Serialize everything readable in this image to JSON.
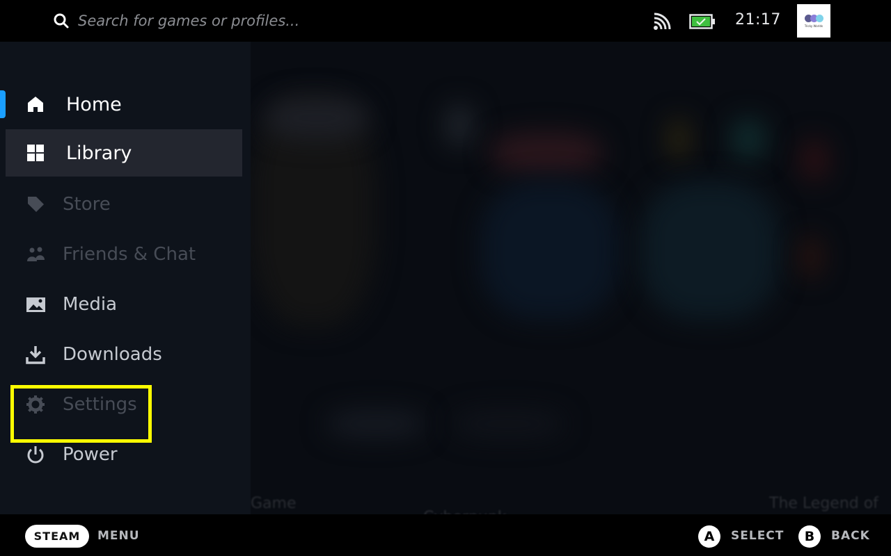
{
  "topbar": {
    "search_placeholder": "Search for games or profiles...",
    "icons": {
      "search": "search-icon",
      "network": "wifi-icon",
      "battery": "battery-charging-icon"
    },
    "battery_color": "#3fbf3f",
    "clock": "21:17",
    "avatar": {
      "brand_text": "Tricky Worlds",
      "dot_colors": [
        "#5b5a8f",
        "#8a7ed8",
        "#7fd3ea"
      ]
    }
  },
  "sidebar": {
    "accent_color": "#1a9fff",
    "items": [
      {
        "id": "home",
        "label": "Home",
        "icon": "home-icon",
        "state": "active"
      },
      {
        "id": "library",
        "label": "Library",
        "icon": "grid-icon",
        "state": "focused"
      },
      {
        "id": "store",
        "label": "Store",
        "icon": "tag-icon",
        "state": "disabled"
      },
      {
        "id": "friends",
        "label": "Friends & Chat",
        "icon": "friends-icon",
        "state": "disabled"
      },
      {
        "id": "media",
        "label": "Media",
        "icon": "image-icon",
        "state": "normal"
      },
      {
        "id": "downloads",
        "label": "Downloads",
        "icon": "download-icon",
        "state": "normal"
      },
      {
        "id": "settings",
        "label": "Settings",
        "icon": "gear-icon",
        "state": "disabled"
      },
      {
        "id": "power",
        "label": "Power",
        "icon": "power-icon",
        "state": "normal"
      }
    ],
    "highlight_color": "#ffff00",
    "highlighted_item": "power"
  },
  "background": {
    "visible_text": [
      "Game",
      "Cyberpunk",
      "The Legend of"
    ]
  },
  "bottombar": {
    "steam_label": "STEAM",
    "menu_label": "MENU",
    "a_button": "A",
    "select_label": "SELECT",
    "b_button": "B",
    "back_label": "BACK"
  }
}
